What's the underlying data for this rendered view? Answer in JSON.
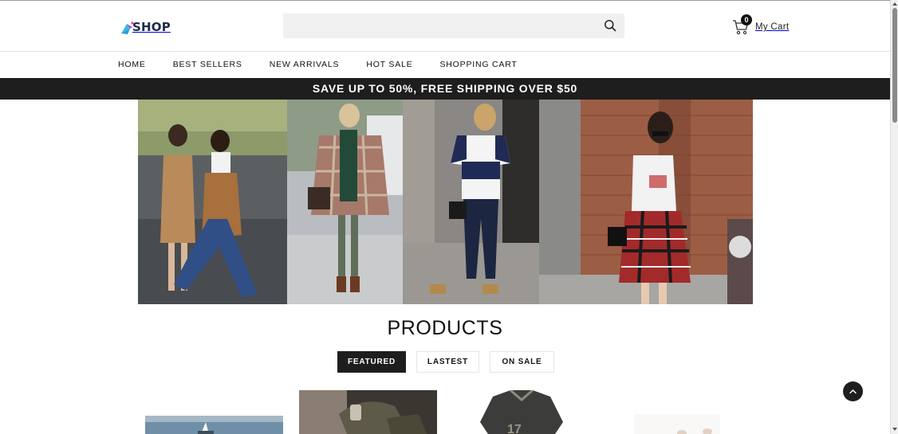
{
  "header": {
    "logo_text": "SHOP",
    "search": {
      "value": "",
      "placeholder": ""
    },
    "cart": {
      "count": "0",
      "label": "My Cart"
    }
  },
  "nav": {
    "items": [
      {
        "label": "HOME"
      },
      {
        "label": "BEST SELLERS"
      },
      {
        "label": "NEW ARRIVALS"
      },
      {
        "label": "HOT SALE"
      },
      {
        "label": "SHOPPING CART"
      }
    ]
  },
  "promo": {
    "text": "SAVE UP TO 50%, FREE SHIPPING OVER $50"
  },
  "hero": {
    "panels": [
      "street-style-two-women-photo",
      "plaid-poncho-woman-photo",
      "striped-tee-woman-photo",
      "plaid-skirt-woman-photo"
    ]
  },
  "products": {
    "title": "PRODUCTS",
    "tabs": [
      {
        "label": "FEATURED",
        "active": true
      },
      {
        "label": "LASTEST",
        "active": false
      },
      {
        "label": "ON SALE",
        "active": false
      }
    ]
  },
  "colors": {
    "accent_dark": "#1e1e1e",
    "search_bg": "#f0f0f0",
    "logo_navy": "#1d2a4a"
  },
  "icons": {
    "search": "search-icon",
    "cart": "cart-icon",
    "back_to_top": "chevron-up-icon"
  }
}
